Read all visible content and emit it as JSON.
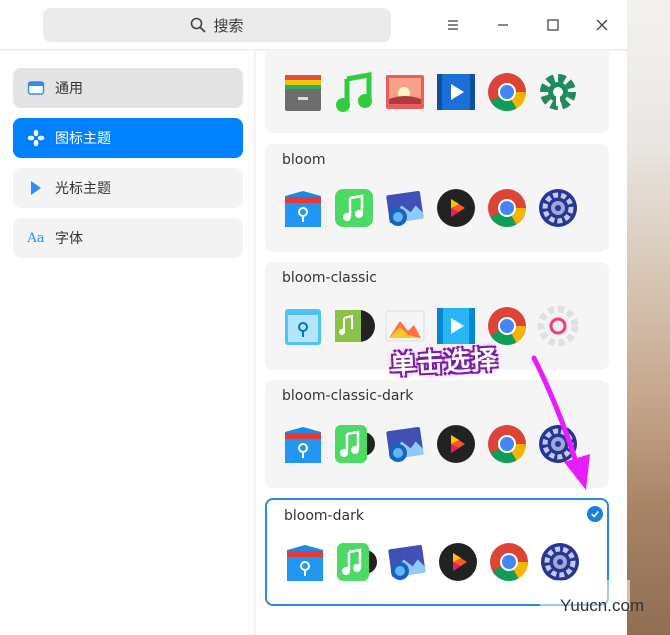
{
  "search": {
    "label": "搜索"
  },
  "sidebar": {
    "items": [
      {
        "label": "通用"
      },
      {
        "label": "图标主题"
      },
      {
        "label": "光标主题"
      },
      {
        "label": "字体"
      }
    ]
  },
  "themes": [
    {
      "name": "",
      "icons": [
        "file-manager-icon",
        "music-icon",
        "photos-icon",
        "video-icon",
        "chrome-icon",
        "settings-gear-icon"
      ]
    },
    {
      "name": "bloom",
      "icons": [
        "file-manager-icon",
        "music-icon",
        "photos-icon",
        "player-icon",
        "chrome-icon",
        "settings-icon"
      ]
    },
    {
      "name": "bloom-classic",
      "icons": [
        "file-manager-icon",
        "music-icon",
        "photos-icon",
        "video-icon",
        "chrome-icon",
        "settings-icon"
      ]
    },
    {
      "name": "bloom-classic-dark",
      "icons": [
        "file-manager-icon",
        "music-icon",
        "photos-icon",
        "player-icon",
        "chrome-icon",
        "settings-icon"
      ]
    },
    {
      "name": "bloom-dark",
      "icons": [
        "file-manager-icon",
        "music-icon",
        "photos-icon",
        "player-icon",
        "chrome-icon",
        "settings-icon"
      ]
    }
  ],
  "annotation": {
    "text": "单击选择"
  },
  "watermark": {
    "text": "Yuucn.com"
  },
  "colors": {
    "accent": "#0081ff",
    "annotation": "#e81cff"
  }
}
